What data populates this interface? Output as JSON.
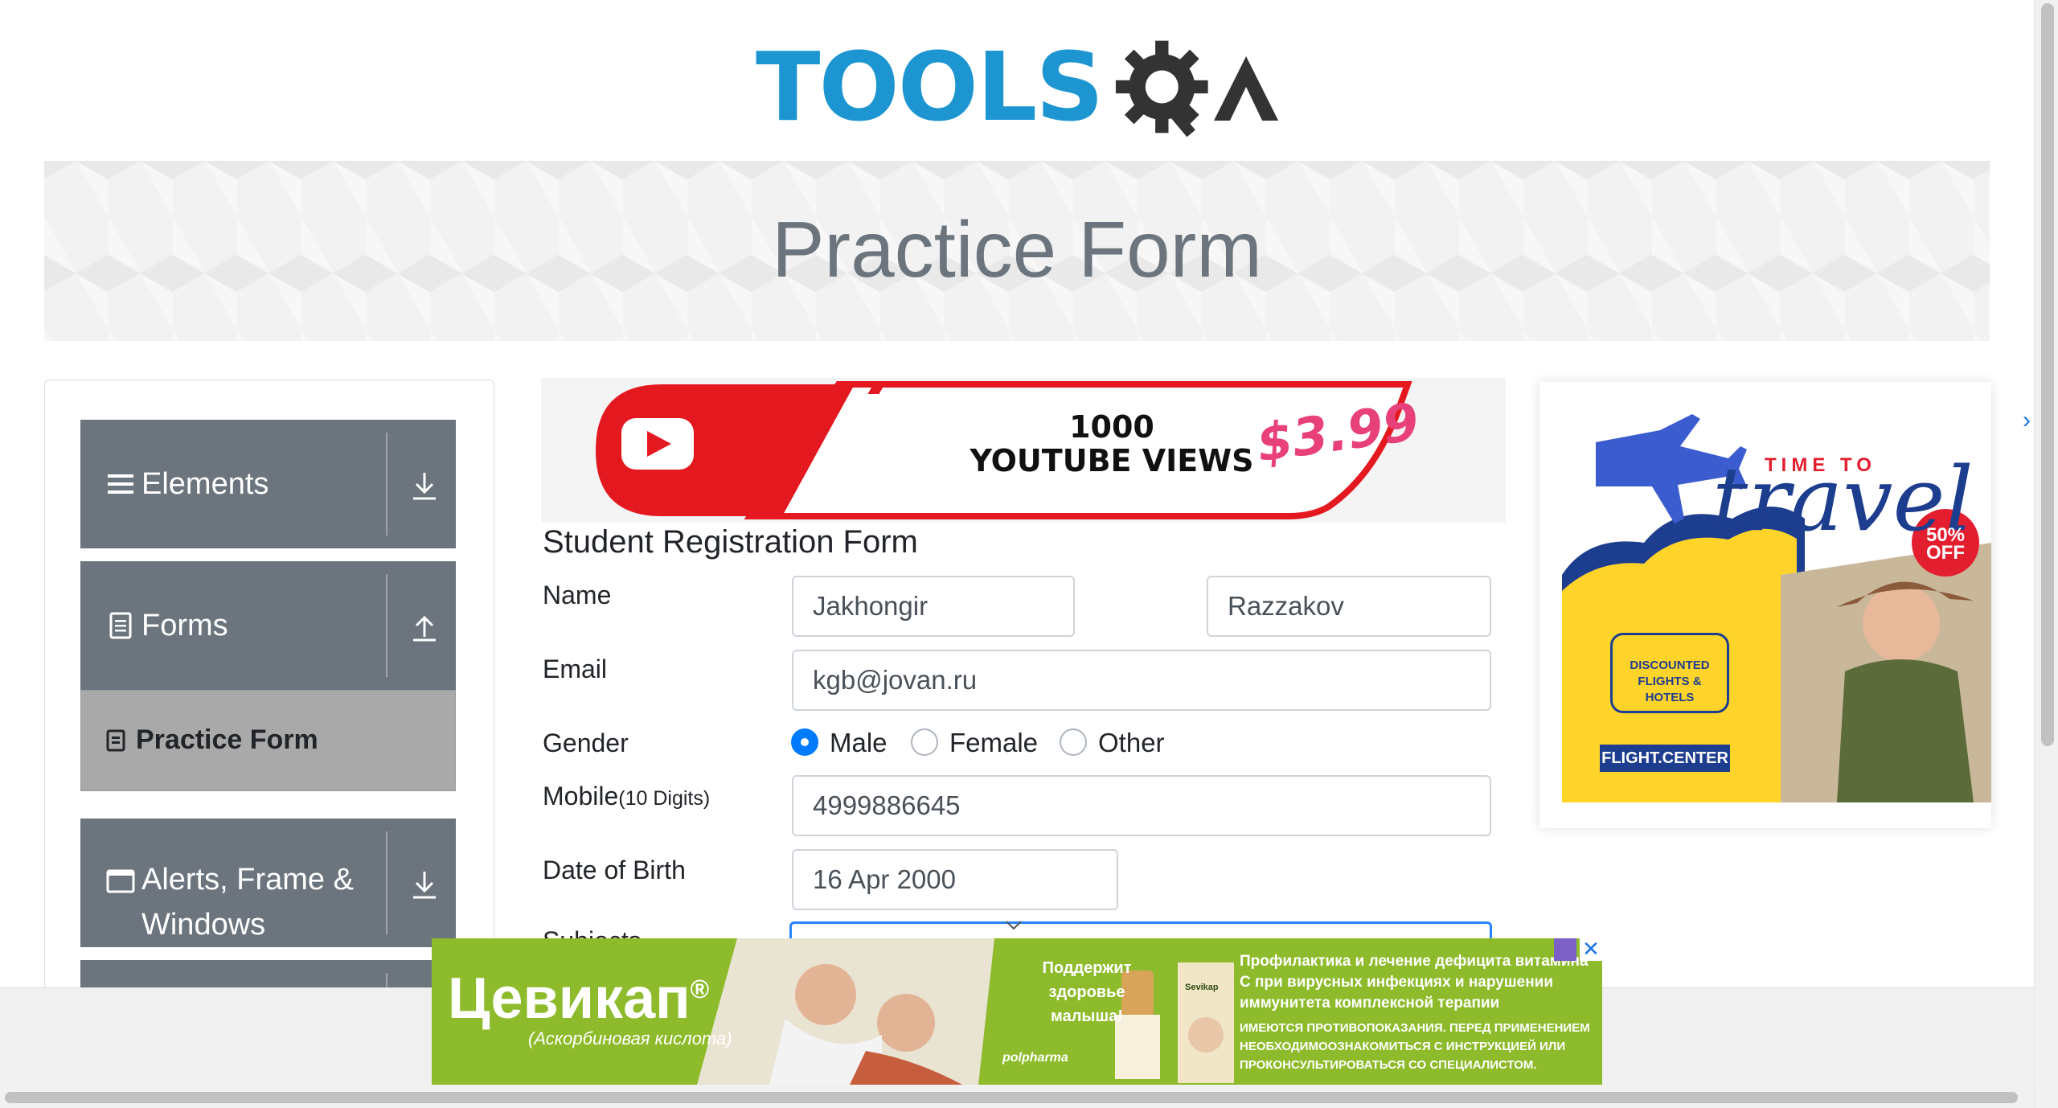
{
  "header": {
    "logo_text": "TOOLS",
    "logo_text_suffix": "QA",
    "banner_title": "Practice Form"
  },
  "sidebar": {
    "groups": [
      {
        "label": "Elements",
        "icon": "hamburger-icon",
        "arrow": "arrow-down-icon"
      },
      {
        "label": "Forms",
        "icon": "document-icon",
        "arrow": "arrow-up-icon"
      },
      {
        "label_line1": "Alerts, Frame &",
        "label_line2": "Windows",
        "icon": "window-icon",
        "arrow": "arrow-down-icon"
      }
    ],
    "active_item": {
      "label": "Practice Form",
      "icon": "practice-form-icon"
    }
  },
  "yt_ad": {
    "line1": "1000",
    "line2": "YOUTUBE VIEWS",
    "price": "$3.99"
  },
  "form": {
    "title": "Student Registration Form",
    "name_label": "Name",
    "first_name": "Jakhongir",
    "last_name": "Razzakov",
    "email_label": "Email",
    "email": "kgb@jovan.ru",
    "gender_label": "Gender",
    "gender_options": [
      "Male",
      "Female",
      "Other"
    ],
    "gender_selected": "Male",
    "mobile_label": "Mobile",
    "mobile_hint": "(10 Digits)",
    "mobile": "4999886645",
    "dob_label": "Date of Birth",
    "dob": "16 Apr 2000",
    "subjects_label": "Subjects"
  },
  "right_ad": {
    "headline_small": "TIME TO",
    "headline_big": "travel",
    "badge_line1": "50%",
    "badge_line2": "OFF",
    "bubble_line1": "DISCOUNTED",
    "bubble_line2": "FLIGHTS & HOTELS",
    "brand": "FLIGHT.CENTER",
    "close_glyph": "›"
  },
  "bottom_ad": {
    "brand": "Цевикап",
    "brand_mark": "®",
    "brand_sub": "(Аскорбиновая кислота)",
    "mid_line1": "Поддержит",
    "mid_line2": "здоровье",
    "mid_line3": "малыша!",
    "maker": "polpharma",
    "right_text": "Профилактика и лечение дефицита витамина С при вирусных инфекциях и нарушении иммунитета комплексной терапии",
    "disclaimer": "ИМЕЮТСЯ ПРОТИВОПОКАЗАНИЯ. ПЕРЕД ПРИМЕНЕНИЕМ НЕОБХОДИМООЗНАКОМИТЬСЯ С ИНСТРУКЦИЕЙ ИЛИ ПРОКОНСУЛЬТИРОВАТЬСЯ СО СПЕЦИАЛИСТОМ.",
    "close_glyph": "✕",
    "package_label": "Sevikap"
  },
  "colors": {
    "brand_blue": "#1c95d1",
    "sidebar_gray": "#6c757d",
    "active_item_gray": "#a9a9a9",
    "radio_blue": "#007bff",
    "focus_blue": "#2684ff",
    "ad_green": "#8dbb2b",
    "yt_red": "#e4181f"
  }
}
